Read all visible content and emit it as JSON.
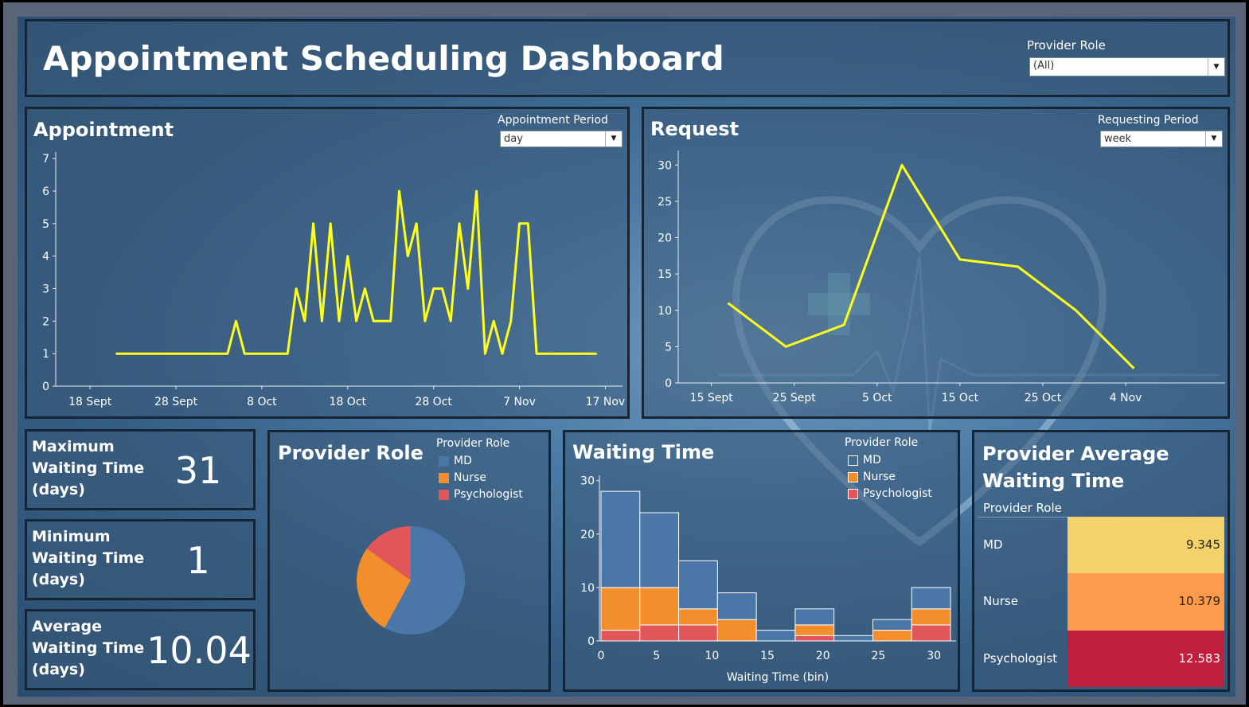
{
  "header": {
    "title": "Appointment Scheduling Dashboard",
    "filter_label": "Provider Role",
    "filter_value": "(All)"
  },
  "colors": {
    "line": "#ffff1a",
    "md": "#4a76a8",
    "nurse": "#f28e2b",
    "psychologist": "#e15759",
    "heat_md": "#f3d26a",
    "heat_nurse": "#fd9a4b",
    "heat_psychologist": "#c01f3c"
  },
  "appointment": {
    "title": "Appointment",
    "period_label": "Appointment Period",
    "period_value": "day"
  },
  "request": {
    "title": "Request",
    "period_label": "Requesting Period",
    "period_value": "week"
  },
  "kpis": [
    {
      "label": [
        "Maximum",
        "Waiting Time",
        "(days)"
      ],
      "value": "31"
    },
    {
      "label": [
        "Minimum",
        "Waiting Time",
        "(days)"
      ],
      "value": "1"
    },
    {
      "label": [
        "Average",
        "Waiting Time",
        "(days)"
      ],
      "value": "10.04"
    }
  ],
  "provider_role_panel": {
    "title": "Provider Role",
    "legend_title": "Provider Role",
    "legend": [
      "MD",
      "Nurse",
      "Psychologist"
    ]
  },
  "waiting_panel": {
    "title": "Waiting Time",
    "legend_title": "Provider Role",
    "legend": [
      "MD",
      "Nurse",
      "Psychologist"
    ]
  },
  "avg_panel": {
    "title_line1": "Provider Average",
    "title_line2": "Waiting Time",
    "column_header": "Provider Role"
  },
  "chart_data": [
    {
      "id": "appointments",
      "type": "line",
      "x": [
        "2023-09-21",
        "2023-09-22",
        "2023-09-23",
        "2023-09-24",
        "2023-09-25",
        "2023-09-26",
        "2023-09-27",
        "2023-09-28",
        "2023-09-29",
        "2023-09-30",
        "2023-10-01",
        "2023-10-02",
        "2023-10-03",
        "2023-10-04",
        "2023-10-05",
        "2023-10-06",
        "2023-10-07",
        "2023-10-08",
        "2023-10-09",
        "2023-10-10",
        "2023-10-11",
        "2023-10-12",
        "2023-10-13",
        "2023-10-14",
        "2023-10-15",
        "2023-10-16",
        "2023-10-17",
        "2023-10-18",
        "2023-10-19",
        "2023-10-20",
        "2023-10-21",
        "2023-10-22",
        "2023-10-23",
        "2023-10-24",
        "2023-10-25",
        "2023-10-26",
        "2023-10-27",
        "2023-10-28",
        "2023-10-29",
        "2023-10-30",
        "2023-10-31",
        "2023-11-01",
        "2023-11-02",
        "2023-11-03",
        "2023-11-04",
        "2023-11-05",
        "2023-11-06",
        "2023-11-07",
        "2023-11-08",
        "2023-11-09",
        "2023-11-10",
        "2023-11-11",
        "2023-11-12",
        "2023-11-13",
        "2023-11-14",
        "2023-11-15",
        "2023-11-16"
      ],
      "y": [
        1,
        1,
        1,
        1,
        1,
        1,
        1,
        1,
        1,
        1,
        1,
        1,
        1,
        1,
        2,
        1,
        1,
        1,
        1,
        1,
        1,
        3,
        2,
        5,
        2,
        5,
        2,
        4,
        2,
        3,
        2,
        2,
        2,
        6,
        4,
        5,
        2,
        3,
        3,
        2,
        5,
        3,
        6,
        1,
        2,
        1,
        2,
        5,
        5,
        1,
        1,
        1,
        1,
        1,
        1,
        1,
        1
      ],
      "xlabel": "",
      "ylabel": "",
      "x_ticks": [
        "18 Sept",
        "28 Sept",
        "8 Oct",
        "18 Oct",
        "28 Oct",
        "7 Nov",
        "17 Nov"
      ],
      "y_ticks": [
        "0",
        "1",
        "2",
        "3",
        "4",
        "5",
        "6",
        "7"
      ],
      "ylim": [
        0,
        7.2
      ],
      "grid": false
    },
    {
      "id": "requests",
      "type": "line",
      "x": [
        "2023-09-17",
        "2023-09-24",
        "2023-10-01",
        "2023-10-08",
        "2023-10-15",
        "2023-10-22",
        "2023-10-29",
        "2023-11-05"
      ],
      "y": [
        11,
        5,
        8,
        30,
        17,
        16,
        10,
        2
      ],
      "xlabel": "",
      "ylabel": "",
      "x_ticks": [
        "15 Sept",
        "25 Sept",
        "5 Oct",
        "15 Oct",
        "25 Oct",
        "4 Nov"
      ],
      "y_ticks": [
        "0",
        "5",
        "10",
        "15",
        "20",
        "25",
        "30"
      ],
      "ylim": [
        0,
        32
      ],
      "grid": false
    },
    {
      "id": "provider_role_pie",
      "type": "pie",
      "labels": [
        "MD",
        "Nurse",
        "Psychologist"
      ],
      "values": [
        58,
        27,
        15
      ]
    },
    {
      "id": "waiting_time_hist",
      "type": "bar",
      "stacked": true,
      "categories": [
        0,
        3.5,
        7,
        10.5,
        14,
        17.5,
        21,
        24.5,
        28
      ],
      "series": [
        {
          "name": "MD",
          "values": [
            18,
            14,
            9,
            5,
            2,
            3,
            1,
            2,
            4
          ]
        },
        {
          "name": "Nurse",
          "values": [
            8,
            7,
            3,
            4,
            0,
            2,
            0,
            2,
            3
          ]
        },
        {
          "name": "Psychologist",
          "values": [
            2,
            3,
            3,
            0,
            0,
            1,
            0,
            0,
            3
          ]
        }
      ],
      "xlabel": "Waiting Time (bin)",
      "x_ticks": [
        "0",
        "5",
        "10",
        "15",
        "20",
        "25",
        "30"
      ],
      "y_ticks": [
        "0",
        "10",
        "20",
        "30"
      ],
      "ylim": [
        0,
        31
      ]
    },
    {
      "id": "provider_avg_waiting",
      "type": "heatmap",
      "categories": [
        "MD",
        "Nurse",
        "Psychologist"
      ],
      "values": [
        "9.345",
        "10.379",
        "12.583"
      ]
    }
  ]
}
